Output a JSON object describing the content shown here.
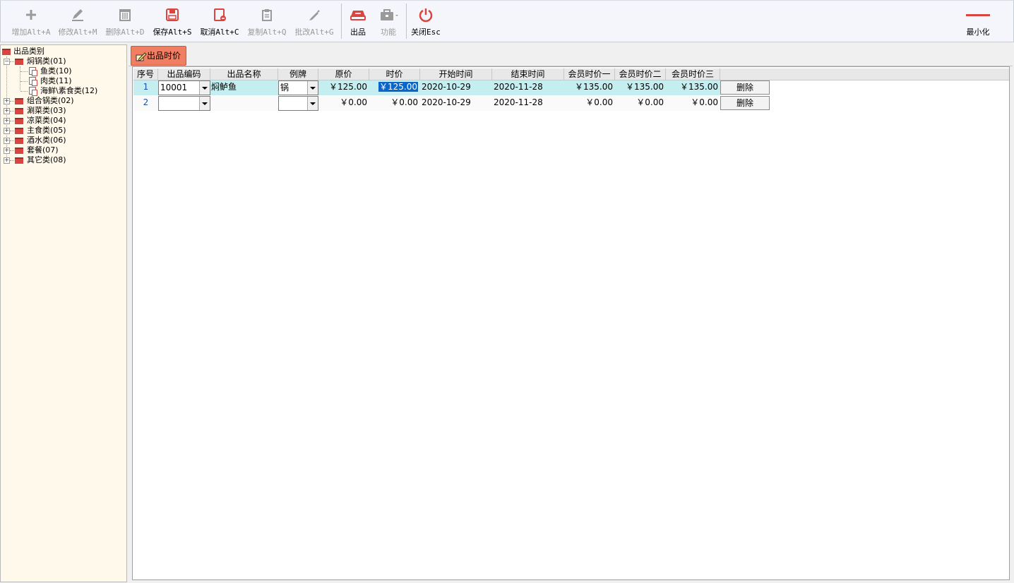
{
  "toolbar": {
    "add": "增加Alt+A",
    "edit": "修改Alt+M",
    "delete": "删除Alt+D",
    "save": "保存Alt+S",
    "cancel": "取消Alt+C",
    "copy": "复制Alt+Q",
    "batch_edit": "批改Alt+G",
    "dish": "出品",
    "function": "功能",
    "close": "关闭Esc",
    "minimize": "最小化"
  },
  "tree": {
    "root": "出品类别",
    "categories": [
      {
        "label": "焖锅类(01)"
      },
      {
        "label": "鱼类(10)"
      },
      {
        "label": "肉类(11)"
      },
      {
        "label": "海鲜\\素食类(12)"
      },
      {
        "label": "组合锅类(02)"
      },
      {
        "label": "涮菜类(03)"
      },
      {
        "label": "凉菜类(04)"
      },
      {
        "label": "主食类(05)"
      },
      {
        "label": "酒水类(06)"
      },
      {
        "label": "套餐(07)"
      },
      {
        "label": "其它类(08)"
      }
    ]
  },
  "tab": {
    "label": "出品时价"
  },
  "grid": {
    "columns": [
      "序号",
      "出品编码",
      "出品名称",
      "例牌",
      "原价",
      "时价",
      "开始时间",
      "结束时间",
      "会员时价一",
      "会员时价二",
      "会员时价三"
    ],
    "rows": [
      {
        "seq": "1",
        "code": "10001",
        "name": "焖鲈鱼",
        "size": "锅",
        "orig": "￥125.00",
        "price": "￥125.00",
        "start": "2020-10-29",
        "end": "2020-11-28",
        "m1": "￥135.00",
        "m2": "￥135.00",
        "m3": "￥135.00",
        "del": "删除"
      },
      {
        "seq": "2",
        "code": "",
        "name": "",
        "size": "",
        "orig": "￥0.00",
        "price": "￥0.00",
        "start": "2020-10-29",
        "end": "2020-11-28",
        "m1": "￥0.00",
        "m2": "￥0.00",
        "m3": "￥0.00",
        "del": "删除"
      }
    ]
  },
  "colors": {
    "accent": "#d9453f",
    "tab": "#f07e63",
    "row_highlight": "#c5eef0",
    "selection": "#0a66c9"
  }
}
